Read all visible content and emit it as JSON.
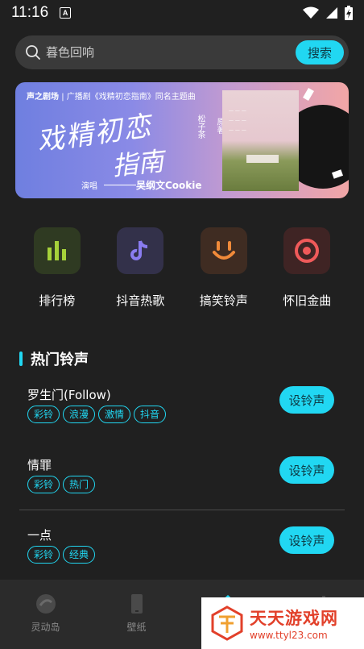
{
  "status_bar": {
    "time": "11:16",
    "a_icon": "A"
  },
  "search": {
    "placeholder": "暮色回响",
    "button_label": "搜索"
  },
  "banner": {
    "top_label_bold": "声之剧场",
    "top_label_rest": "| 广播剧《戏精初恋指南》同名主题曲",
    "title_line1": "戏精初恋",
    "title_line2": "指南",
    "singer_label": "演唱",
    "singer": "吴纲文Cookie",
    "author_line1": "松子茶",
    "author_line2": "原著"
  },
  "categories": [
    {
      "label": "排行榜",
      "icon": "chart-bars-icon",
      "bg": "#2f3a22",
      "color": "#a6d13a"
    },
    {
      "label": "抖音热歌",
      "icon": "tiktok-note-icon",
      "bg": "#33314a",
      "color": "#8a7cf0"
    },
    {
      "label": "搞笑铃声",
      "icon": "smile-icon",
      "bg": "#3f2c22",
      "color": "#f08a3a"
    },
    {
      "label": "怀旧金曲",
      "icon": "vinyl-target-icon",
      "bg": "#3f2424",
      "color": "#f05a5a"
    }
  ],
  "section": {
    "title": "热门铃声"
  },
  "songs": [
    {
      "title": "罗生门(Follow)",
      "tags": [
        "彩铃",
        "浪漫",
        "激情",
        "抖音"
      ],
      "button": "设铃声"
    },
    {
      "title": "情罪",
      "tags": [
        "彩铃",
        "热门"
      ],
      "button": "设铃声"
    },
    {
      "title": "一点",
      "tags": [
        "彩铃",
        "经典"
      ],
      "button": "设铃声"
    }
  ],
  "bottom_nav": [
    {
      "label": "灵动岛",
      "icon": "island-icon"
    },
    {
      "label": "壁纸",
      "icon": "phone-icon"
    },
    {
      "label": "",
      "icon": "home-icon"
    },
    {
      "label": "",
      "icon": "music-icon"
    }
  ],
  "watermark": {
    "title": "天天游戏网",
    "url": "www.ttyl23.com"
  },
  "colors": {
    "accent": "#21d7f2",
    "background": "#202020"
  }
}
